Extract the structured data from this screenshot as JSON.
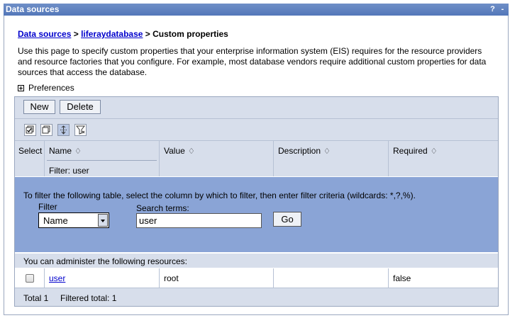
{
  "titlebar": {
    "title": "Data sources",
    "help": "?",
    "minimize": "-"
  },
  "breadcrumb": {
    "link1": "Data sources",
    "sep1": " > ",
    "link2": "liferaydatabase",
    "sep2": " > ",
    "current": "Custom properties"
  },
  "description": "Use this page to specify custom properties that your enterprise information system (EIS) requires for the resource providers and resource factories that you configure. For example, most database vendors require additional custom properties for data sources that access the database.",
  "preferences": "Preferences",
  "buttons": {
    "new": "New",
    "delete": "Delete"
  },
  "toolbar_icons": [
    "select-all-icon",
    "deselect-all-icon",
    "show-filter-icon",
    "clear-filter-icon"
  ],
  "table": {
    "columns": [
      "Select",
      "Name",
      "Value",
      "Description",
      "Required"
    ],
    "sort_glyph": "♢",
    "filter_label": "Filter: user",
    "rows": [
      {
        "name": "user",
        "value": "root",
        "description": "",
        "required": "false"
      }
    ]
  },
  "filter_panel": {
    "instructions": "To filter the following table, select the column by which to filter, then enter filter criteria (wildcards: *,?,%).",
    "filter_label": "Filter",
    "filter_value": "Name",
    "search_label": "Search terms:",
    "search_value": "user",
    "go": "Go"
  },
  "admin_text": "You can administer the following resources:",
  "footer": {
    "total": "Total 1",
    "filtered": "Filtered total: 1"
  },
  "colors": {
    "title_bar": "#5a7dbd",
    "filter_panel": "#8aa4d6",
    "table_header": "#d7deeb",
    "link": "#0000cc"
  }
}
